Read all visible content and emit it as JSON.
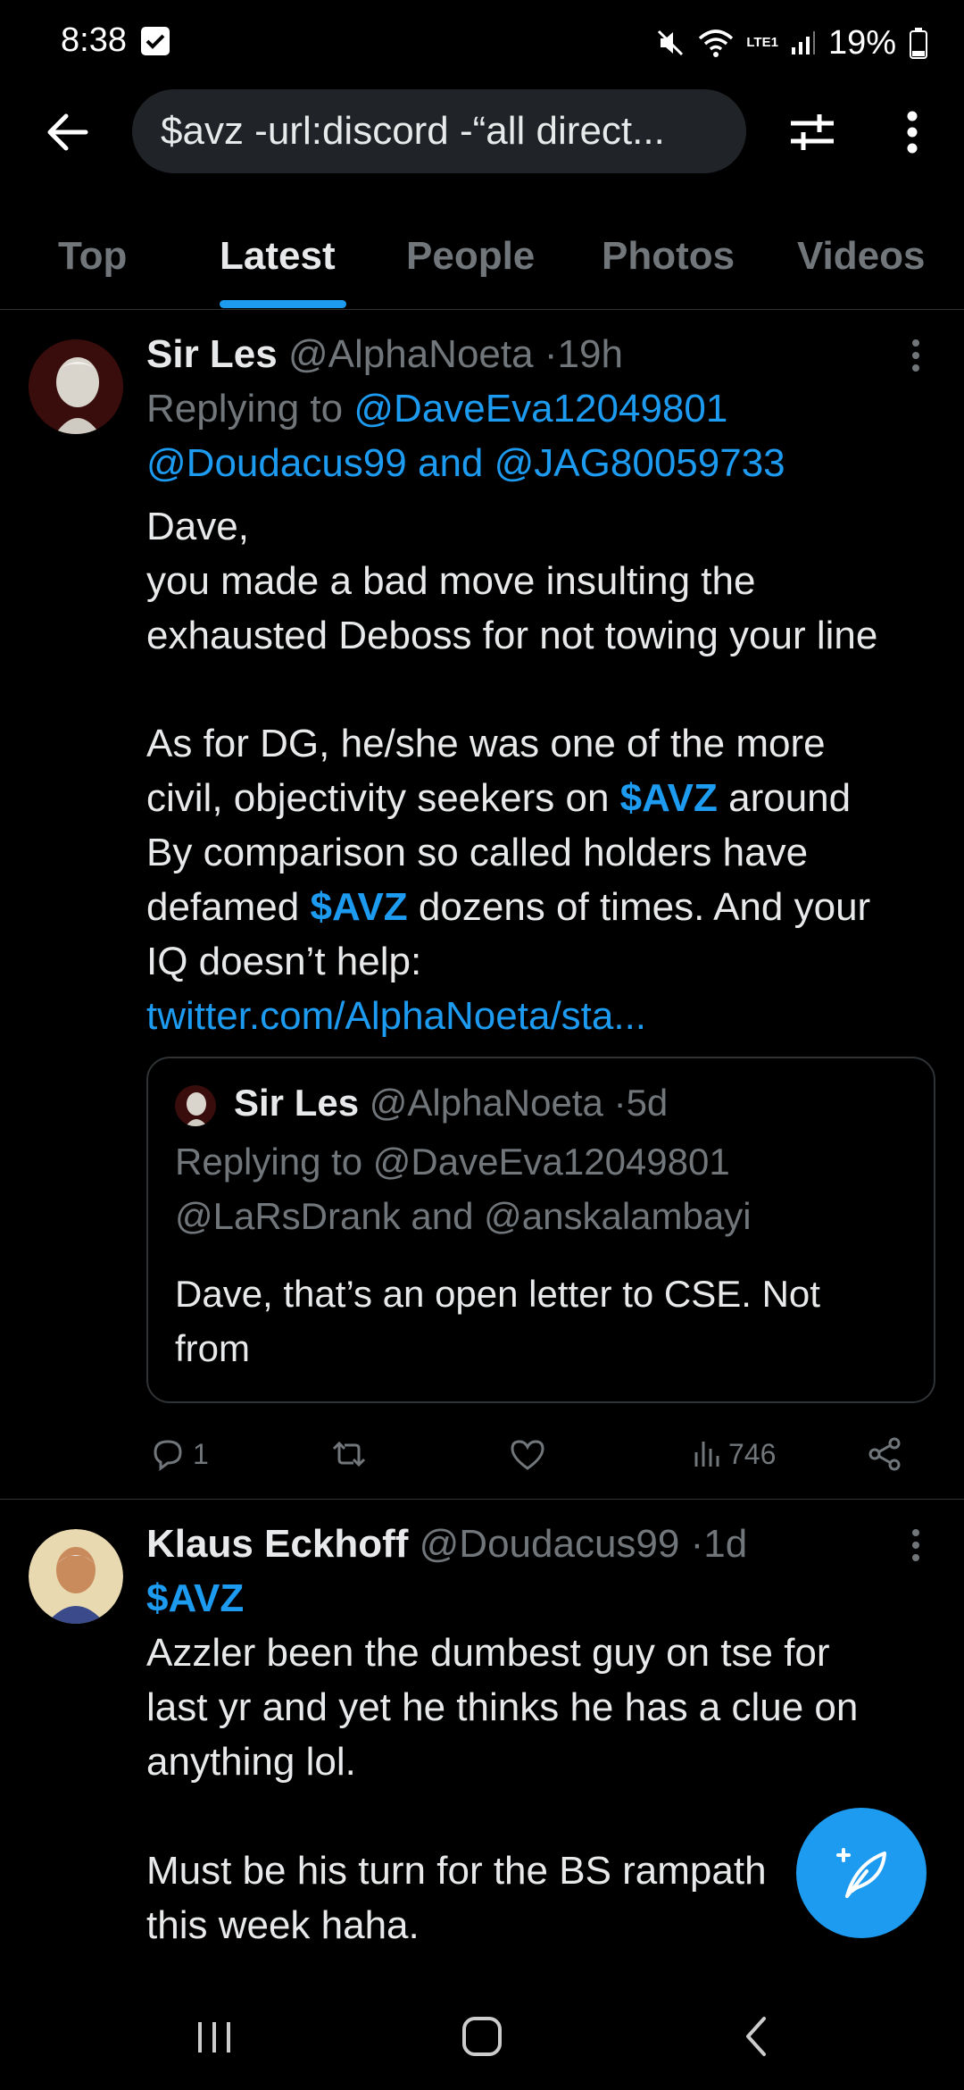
{
  "status": {
    "time": "8:38",
    "battery": "19%",
    "network": "LTE1"
  },
  "search": {
    "query": "$avz -url:discord -“all direct..."
  },
  "tabs": [
    {
      "label": "Top"
    },
    {
      "label": "Latest"
    },
    {
      "label": "People"
    },
    {
      "label": "Photos"
    },
    {
      "label": "Videos"
    }
  ],
  "tweet1": {
    "name": "Sir Les",
    "handle": "@AlphaNoeta",
    "dot": "·",
    "time": "19h",
    "replying_prefix": "Replying to",
    "reply_user1": "@DaveEva12049801",
    "reply_user2": "@Doudacus99",
    "and": "and",
    "reply_user3": "@JAG80059733",
    "line1": "Dave,",
    "line2": "you made a bad move insulting the",
    "line3": "exhausted Deboss for not towing your line",
    "line4": "As for DG, he/she was one of the more",
    "line5_a": "civil, objectivity seekers on ",
    "cashtag": "$AVZ",
    "line5_b": " around",
    "line6": "By comparison so called holders have",
    "line7_a": "defamed ",
    "line7_b": " dozens of times. And your",
    "line8": "IQ doesn’t help:",
    "link": "twitter.com/AlphaNoeta/sta...",
    "quote": {
      "name": "Sir Les",
      "handle": "@AlphaNoeta",
      "dot": "·",
      "time": "5d",
      "line1": "Replying to @DaveEva12049801",
      "line2": "@LaRsDrank and @anskalambayi",
      "text1": "Dave, that’s an open letter to CSE. Not",
      "text2": "from"
    },
    "replies": "1",
    "views": "746"
  },
  "tweet2": {
    "name": "Klaus Eckhoff",
    "handle": "@Doudacus99",
    "dot": "·",
    "time": "1d",
    "cashtag": "$AVZ",
    "line1": "Azzler been the dumbest guy on tse for",
    "line2": "last yr and yet he thinks he has a clue on",
    "line3": "anything lol.",
    "line4": "Must be his turn for the BS rampath",
    "line5": "this week haha."
  },
  "colors": {
    "accent": "#1d9bf0",
    "background": "#000000",
    "muted": "#71767b",
    "text": "#e7e9ea"
  }
}
